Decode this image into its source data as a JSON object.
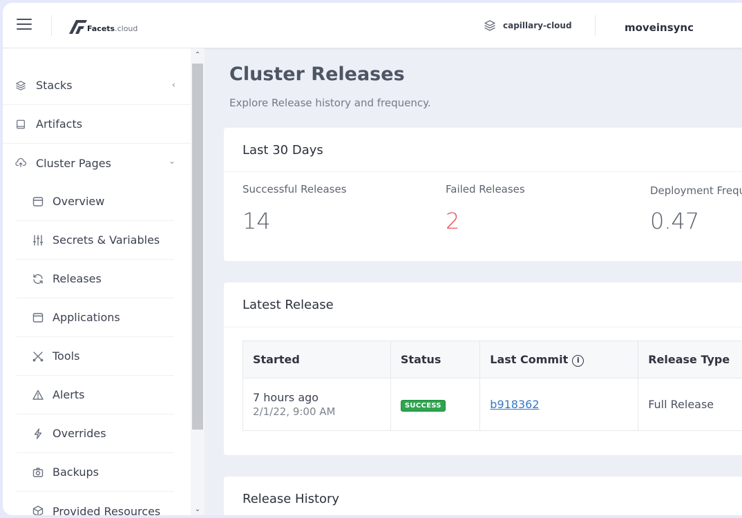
{
  "header": {
    "logo_text_bold": "Facets",
    "logo_text_light": ".cloud",
    "stack_name": "capillary-cloud",
    "org_name": "moveinsync"
  },
  "sidebar": {
    "top_items": [
      {
        "label": "Stacks",
        "icon": "layers-icon"
      },
      {
        "label": "Artifacts",
        "icon": "tablet-icon"
      },
      {
        "label": "Cluster Pages",
        "icon": "cloud-upload-icon"
      }
    ],
    "sub_items": [
      {
        "label": "Overview",
        "icon": "archive-icon"
      },
      {
        "label": "Secrets & Variables",
        "icon": "sliders-icon"
      },
      {
        "label": "Releases",
        "icon": "refresh-icon"
      },
      {
        "label": "Applications",
        "icon": "window-icon"
      },
      {
        "label": "Tools",
        "icon": "tools-icon"
      },
      {
        "label": "Alerts",
        "icon": "warning-icon"
      },
      {
        "label": "Overrides",
        "icon": "bolt-icon"
      },
      {
        "label": "Backups",
        "icon": "camera-icon"
      },
      {
        "label": "Provided Resources",
        "icon": "box-icon"
      }
    ]
  },
  "main": {
    "title": "Cluster Releases",
    "subtitle": "Explore Release history and frequency.",
    "summary": {
      "title": "Last 30 Days",
      "stats": [
        {
          "label": "Successful Releases",
          "value": "14"
        },
        {
          "label": "Failed Releases",
          "value": "2"
        },
        {
          "label": "Deployment Frequency",
          "value": "0.47"
        }
      ]
    },
    "latest": {
      "title": "Latest Release",
      "columns": [
        "Started",
        "Status",
        "Last Commit",
        "Release Type"
      ],
      "row": {
        "started_relative": "7 hours ago",
        "started_absolute": "2/1/22, 9:00 AM",
        "status": "SUCCESS",
        "commit": "b918362",
        "release_type": "Full Release"
      }
    },
    "history": {
      "title": "Release History"
    }
  },
  "colors": {
    "success": "#2ea44f",
    "failed": "#e4565d",
    "link": "#3576c6"
  }
}
